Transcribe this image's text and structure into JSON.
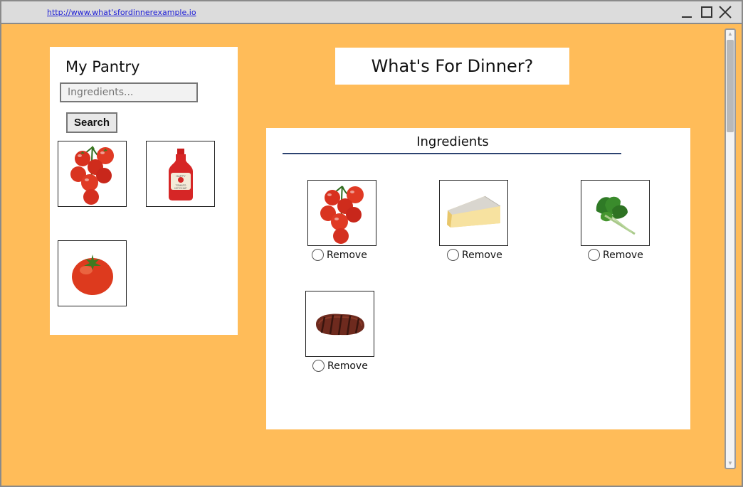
{
  "browser": {
    "url": "http://www.what'sfordinnerexample.io",
    "minimize_icon": "minimize-icon",
    "maximize_icon": "maximize-icon",
    "close_icon": "close-icon"
  },
  "pantry": {
    "title": "My Pantry",
    "search_placeholder": "Ingredients...",
    "search_button": "Search",
    "items": [
      {
        "icon": "tomatoes-icon"
      },
      {
        "icon": "ketchup-bottle-icon"
      },
      {
        "icon": "tomato-icon"
      }
    ],
    "ketchup_label": "HAPPY TOMATO KETCHUP"
  },
  "header": {
    "title": "What's For Dinner?"
  },
  "ingredients": {
    "title": "Ingredients",
    "items": [
      {
        "icon": "tomatoes-icon",
        "remove_label": "Remove"
      },
      {
        "icon": "cheese-icon",
        "remove_label": "Remove"
      },
      {
        "icon": "spinach-icon",
        "remove_label": "Remove"
      },
      {
        "icon": "steak-icon",
        "remove_label": "Remove"
      }
    ]
  },
  "colors": {
    "background": "#ffbc59",
    "panel": "#ffffff",
    "rule": "#2c4370"
  }
}
